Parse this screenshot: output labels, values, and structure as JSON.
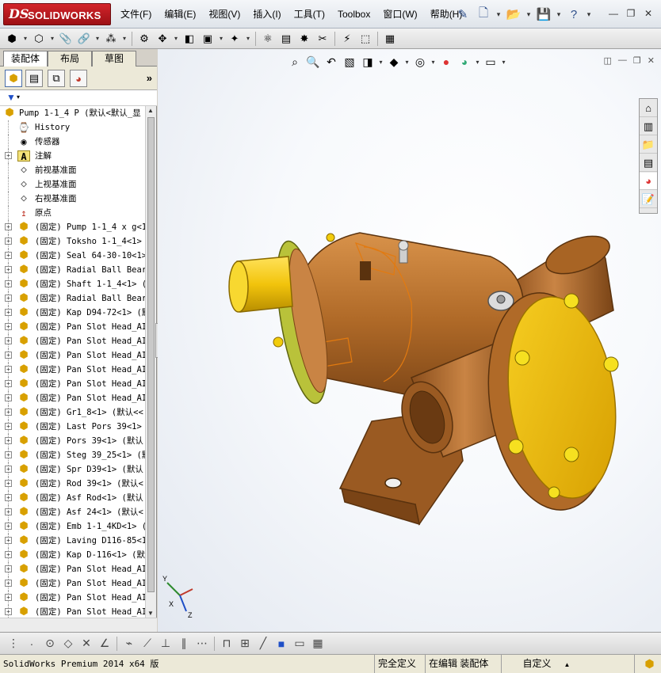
{
  "app": {
    "logo_ds": "DS",
    "logo_text": "SOLIDWORKS",
    "menu": [
      "文件(F)",
      "编辑(E)",
      "视图(V)",
      "插入(I)",
      "工具(T)",
      "Toolbox",
      "窗口(W)",
      "帮助(H)"
    ]
  },
  "left_pane": {
    "tabs": [
      "装配体",
      "布局",
      "草图"
    ],
    "tree_root": "Pump 1-1_4 P  (默认<默认_显",
    "tree": [
      {
        "label": "History",
        "icon": "history-icon",
        "expander": false
      },
      {
        "label": "传感器",
        "icon": "sensor-icon",
        "expander": false
      },
      {
        "label": "注解",
        "icon": "annotation-icon",
        "expander": true
      },
      {
        "label": "前视基准面",
        "icon": "plane-icon",
        "expander": false
      },
      {
        "label": "上视基准面",
        "icon": "plane-icon",
        "expander": false
      },
      {
        "label": "右视基准面",
        "icon": "plane-icon",
        "expander": false
      },
      {
        "label": "原点",
        "icon": "origin-icon",
        "expander": false
      },
      {
        "label": "(固定) Pump 1-1_4 x g<1",
        "icon": "part-icon",
        "expander": true
      },
      {
        "label": "(固定) Toksho 1-1_4<1>",
        "icon": "part-icon",
        "expander": true
      },
      {
        "label": "(固定) Seal 64-30-10<1>",
        "icon": "part-icon",
        "expander": true
      },
      {
        "label": "(固定) Radial Ball Bear",
        "icon": "part-icon",
        "expander": true
      },
      {
        "label": "(固定) Shaft 1-1_4<1> (",
        "icon": "part-icon",
        "expander": true
      },
      {
        "label": "(固定) Radial Ball Bear",
        "icon": "part-icon",
        "expander": true
      },
      {
        "label": "(固定) Kap D94-72<1> (默",
        "icon": "part-icon",
        "expander": true
      },
      {
        "label": "(固定) Pan Slot Head_AI",
        "icon": "part-icon",
        "expander": true
      },
      {
        "label": "(固定) Pan Slot Head_AI",
        "icon": "part-icon",
        "expander": true
      },
      {
        "label": "(固定) Pan Slot Head_AI",
        "icon": "part-icon",
        "expander": true
      },
      {
        "label": "(固定) Pan Slot Head_AI",
        "icon": "part-icon",
        "expander": true
      },
      {
        "label": "(固定) Pan Slot Head_AI",
        "icon": "part-icon",
        "expander": true
      },
      {
        "label": "(固定) Pan Slot Head_AI",
        "icon": "part-icon",
        "expander": true
      },
      {
        "label": "(固定) Gr1_8<1> (默认<<",
        "icon": "part-icon",
        "expander": true
      },
      {
        "label": "(固定) Last Pors 39<1>",
        "icon": "part-icon",
        "expander": true
      },
      {
        "label": "(固定) Pors 39<1> (默认",
        "icon": "part-icon",
        "expander": true
      },
      {
        "label": "(固定) Steg 39_25<1> (默",
        "icon": "part-icon",
        "expander": true
      },
      {
        "label": "(固定) Spr D39<1> (默认",
        "icon": "part-icon",
        "expander": true
      },
      {
        "label": "(固定) Rod 39<1> (默认<",
        "icon": "part-icon",
        "expander": true
      },
      {
        "label": "(固定) Asf Rod<1> (默认",
        "icon": "part-icon",
        "expander": true
      },
      {
        "label": "(固定) Asf 24<1> (默认<",
        "icon": "part-icon",
        "expander": true
      },
      {
        "label": "(固定) Emb 1-1_4KD<1> (",
        "icon": "part-icon",
        "expander": true
      },
      {
        "label": "(固定) Laving D116-85<1",
        "icon": "part-icon",
        "expander": true
      },
      {
        "label": "(固定) Kap D-116<1> (默",
        "icon": "part-icon",
        "expander": true
      },
      {
        "label": "(固定) Pan Slot Head_AI",
        "icon": "part-icon",
        "expander": true
      },
      {
        "label": "(固定) Pan Slot Head_AI",
        "icon": "part-icon",
        "expander": true
      },
      {
        "label": "(固定) Pan Slot Head_AI",
        "icon": "part-icon",
        "expander": true
      },
      {
        "label": "(固定) Pan Slot Head_AI",
        "icon": "part-icon",
        "expander": true
      }
    ]
  },
  "viewport": {
    "triad_labels": [
      "Y",
      "X",
      "Z"
    ]
  },
  "status_bar": {
    "product": "SolidWorks Premium 2014 x64 版",
    "definition": "完全定义",
    "editing": "在编辑 装配体",
    "units": "自定义"
  },
  "colors": {
    "logo_red": "#c41e24",
    "part_bronze": "#b06a28",
    "shaft_yellow": "#f2cc0c",
    "flange_green": "#b9c23a",
    "cover_gold": "#e8b800"
  }
}
